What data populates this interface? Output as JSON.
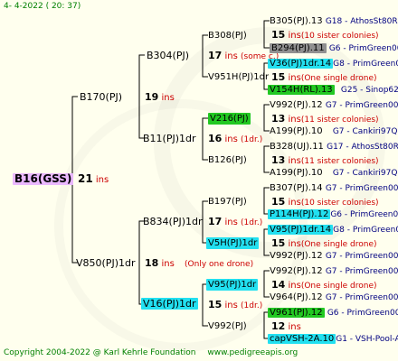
{
  "header": "4-   4-2022 ( 20: 37)",
  "footer": {
    "copyright": "Copyright 2004-2022 @ Karl Kehrle Foundation",
    "site": "www.pedigreeapis.org"
  },
  "ins_word": "ins",
  "root": {
    "name": "B16(GSS)",
    "count": "21"
  },
  "gen1": [
    {
      "name": "B170(PJ)",
      "count": "19"
    },
    {
      "name": "V850(PJ)1dr",
      "count": "18",
      "note": "(Only one drone)"
    }
  ],
  "gen2": [
    {
      "name": "B304(PJ)",
      "count": "17",
      "note": "(some c.)"
    },
    {
      "name": "B11(PJ)1dr",
      "count": "16",
      "note": "(1dr.)"
    },
    {
      "name": "B834(PJ)1dr",
      "count": "17",
      "note": "(1dr.)"
    },
    {
      "name": "V16(PJ)1dr",
      "count": "15",
      "note": "(1dr.)"
    }
  ],
  "gen3": [
    {
      "name": "B308(PJ)"
    },
    {
      "name": "V951H(PJ)1dr"
    },
    {
      "name": "V216(PJ)"
    },
    {
      "name": "B126(PJ)"
    },
    {
      "name": "B197(PJ)"
    },
    {
      "name": "V5H(PJ)1dr"
    },
    {
      "name": "V95(PJ)1dr"
    },
    {
      "name": "V992(PJ)"
    }
  ],
  "gen4": [
    {
      "name": "B305(PJ).13",
      "line": "G18 - AthosSt80R",
      "count": "15",
      "note": "(10 sister colonies)"
    },
    {
      "name": "B294(PJ).11",
      "line": "G6 - PrimGreen00"
    },
    {
      "name": "V36(PJ)1dr.14",
      "line": "G8 - PrimGreen00",
      "count": "15",
      "note": "(One single drone)"
    },
    {
      "name": "V154H(RL).13",
      "line": "G25 - Sinop62R"
    },
    {
      "name": "V992(PJ).12",
      "line": "G7 - PrimGreen00",
      "count": "13",
      "note": "(11 sister colonies)"
    },
    {
      "name": "A199(PJ).10",
      "line": "G7 - Cankiri97Q"
    },
    {
      "name": "B328(UJ).11",
      "line": "G17 - AthosSt80R",
      "count": "13",
      "note": "(11 sister colonies)"
    },
    {
      "name": "A199(PJ).10",
      "line": "G7 - Cankiri97Q"
    },
    {
      "name": "B307(PJ).14",
      "line": "G7 - PrimGreen00",
      "count": "15",
      "note": "(10 sister colonies)"
    },
    {
      "name": "P114H(PJ).12",
      "line": "G6 - PrimGreen00"
    },
    {
      "name": "V95(PJ)1dr.14",
      "line": "G8 - PrimGreen00",
      "count": "15",
      "note": "(One single drone)"
    },
    {
      "name": "V992(PJ).12",
      "line": "G7 - PrimGreen00"
    },
    {
      "name": "V992(PJ).12",
      "line": "G7 - PrimGreen00",
      "count": "14",
      "note": "(One single drone)"
    },
    {
      "name": "V964(PJ).12",
      "line": "G7 - PrimGreen00"
    },
    {
      "name": "V961(PJ).12",
      "line": "G6 - PrimGreen00",
      "count": "12"
    },
    {
      "name": "capVSH-2A.10",
      "line": "G1 - VSH-Pool-AR"
    }
  ]
}
